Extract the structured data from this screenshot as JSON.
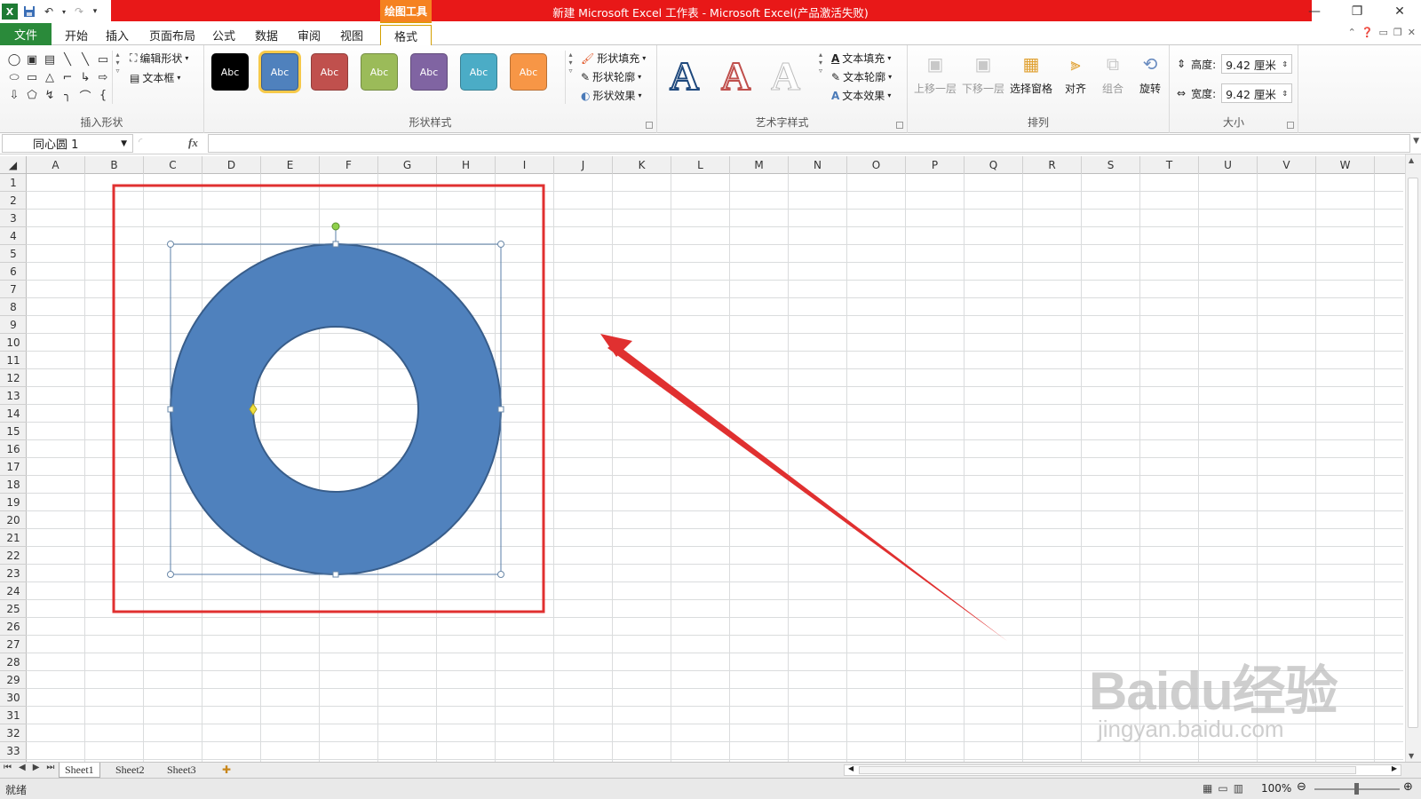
{
  "window": {
    "title": "新建 Microsoft Excel 工作表 - Microsoft Excel(产品激活失败)",
    "context_tab": "绘图工具",
    "colors": {
      "titlebar_red": "#e81818",
      "context_orange": "#f58220",
      "file_green": "#2a8a3a",
      "shape_fill": "#4f81bd",
      "shape_stroke": "#385d8a",
      "highlight_red": "#e03030"
    }
  },
  "qat": {
    "icons": [
      "excel-logo-icon",
      "save-icon",
      "undo-icon",
      "redo-icon",
      "customize-icon"
    ],
    "logo_text": "X"
  },
  "tabs": [
    "文件",
    "开始",
    "插入",
    "页面布局",
    "公式",
    "数据",
    "审阅",
    "视图",
    "格式"
  ],
  "ribbon": {
    "insert_shapes": {
      "label": "插入形状",
      "edit_shape": "编辑形状",
      "text_box": "文本框",
      "shape_glyphs": [
        "◯",
        "▣",
        "▤",
        "╲",
        "╲",
        "▭",
        "⬭",
        "▭",
        "△",
        "⌐",
        "↳",
        "⇨",
        "⇩",
        "⬠",
        "↯",
        "╮",
        "⌒",
        "{"
      ]
    },
    "shape_styles": {
      "label": "形状样式",
      "swatch_text": "Abc",
      "swatches": [
        "#000000",
        "#4f81bd",
        "#c0504d",
        "#9bbb59",
        "#8064a2",
        "#4bacc6",
        "#f79646"
      ],
      "fill": "形状填充",
      "outline": "形状轮廓",
      "effects": "形状效果"
    },
    "wordart": {
      "label": "艺术字样式",
      "letter": "A",
      "fill": "文本填充",
      "outline": "文本轮廓",
      "effects": "文本效果"
    },
    "arrange": {
      "label": "排列",
      "bring_forward": "上移一层",
      "send_backward": "下移一层",
      "selection_pane": "选择窗格",
      "align": "对齐",
      "group": "组合",
      "rotate": "旋转"
    },
    "size": {
      "label": "大小",
      "height_label": "高度:",
      "height_value": "9.42 厘米",
      "width_label": "宽度:",
      "width_value": "9.42 厘米"
    }
  },
  "formula_bar": {
    "name_box": "同心圆 1",
    "fx": "fx",
    "formula": ""
  },
  "columns": [
    "A",
    "B",
    "C",
    "D",
    "E",
    "F",
    "G",
    "H",
    "I",
    "J",
    "K",
    "L",
    "M",
    "N",
    "O",
    "P",
    "Q",
    "R",
    "S",
    "T",
    "U",
    "V",
    "W"
  ],
  "rows": [
    "1",
    "2",
    "3",
    "4",
    "5",
    "6",
    "7",
    "8",
    "9",
    "10",
    "11",
    "12",
    "13",
    "14",
    "15",
    "16",
    "17",
    "18",
    "19",
    "20",
    "21",
    "22",
    "23",
    "24",
    "25",
    "26",
    "27",
    "28",
    "29",
    "30",
    "31",
    "32",
    "33"
  ],
  "sheets": [
    "Sheet1",
    "Sheet2",
    "Sheet3"
  ],
  "status": {
    "ready": "就绪",
    "zoom": "100%"
  },
  "shape": {
    "name": "同心圆 1",
    "type": "donut"
  },
  "watermark": {
    "text": "Baidu经验",
    "url": "jingyan.baidu.com"
  }
}
